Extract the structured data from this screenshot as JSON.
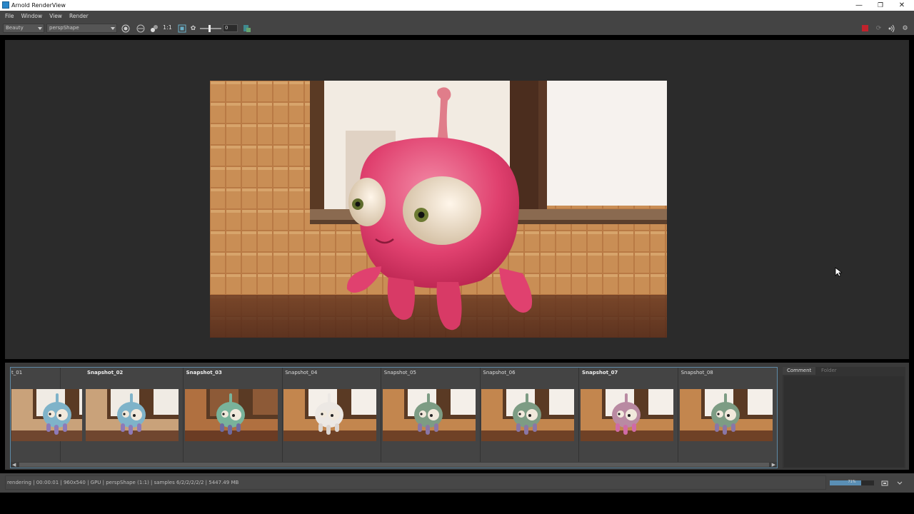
{
  "window": {
    "title": "Arnold RenderView",
    "minimize": "—",
    "restore": "❐",
    "close": "✕"
  },
  "menu": [
    "File",
    "Window",
    "View",
    "Render"
  ],
  "toolbar": {
    "aov_value": "Beauty",
    "camera_value": "perspShape",
    "ratio_label": "1:1",
    "exposure_value": "0",
    "icons": [
      "display-settings-icon",
      "iso-icon",
      "channel-icon",
      "fit-frame-icon",
      "gear-icon",
      "log-icon",
      "stop-render-icon",
      "refresh-icon",
      "ipr-icon",
      "settings-icon"
    ]
  },
  "snapshots": [
    {
      "label": "t_01",
      "bold": false,
      "theme": "blue-window"
    },
    {
      "label": "Snapshot_02",
      "bold": true,
      "theme": "blue-window"
    },
    {
      "label": "Snapshot_03",
      "bold": true,
      "theme": "green-room"
    },
    {
      "label": "Snapshot_04",
      "bold": false,
      "theme": "white"
    },
    {
      "label": "Snapshot_05",
      "bold": false,
      "theme": "green"
    },
    {
      "label": "Snapshot_06",
      "bold": false,
      "theme": "green"
    },
    {
      "label": "Snapshot_07",
      "bold": true,
      "theme": "pink"
    },
    {
      "label": "Snapshot_08",
      "bold": false,
      "theme": "green"
    }
  ],
  "side_panel": {
    "tabs": [
      "Comment",
      "Folder"
    ]
  },
  "status": {
    "text": "rendering | 00:00:01 | 960x540 | GPU | perspShape (1:1) | samples 6/2/2/2/2/2 | 5447.49 MB",
    "progress_label": "71%",
    "progress_fraction": 0.71
  },
  "colors": {
    "accent": "#5e8aa6",
    "stop_red": "#c0232c",
    "creature_pink": "#e0416f"
  }
}
